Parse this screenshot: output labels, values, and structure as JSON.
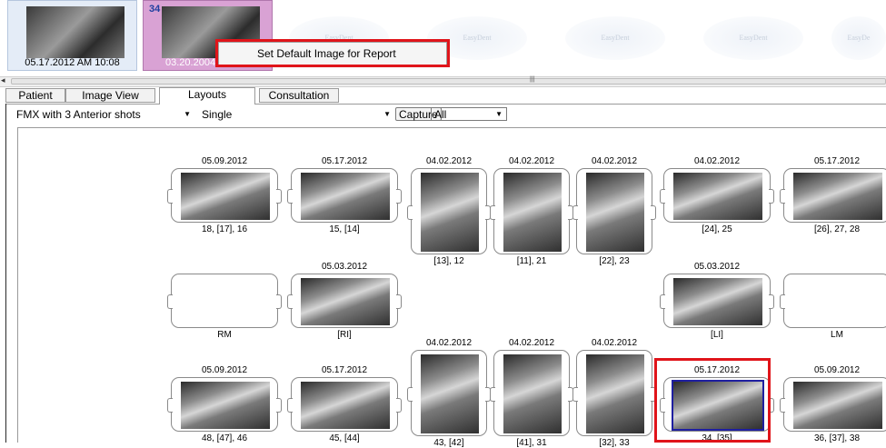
{
  "thumbs": [
    {
      "caption": "05.17.2012 AM 10:08"
    },
    {
      "number": "34",
      "caption": "03.20.2004 PM 08:"
    }
  ],
  "placeholders": [
    "EasyDent",
    "EasyDent",
    "EasyDent",
    "EasyDent",
    "EasyDe"
  ],
  "context_menu": {
    "item": "Set Default Image for Report"
  },
  "tabs": [
    {
      "label": "Patient"
    },
    {
      "label": "Image View"
    },
    {
      "label": "Layouts"
    },
    {
      "label": "Consultation"
    }
  ],
  "active_tab": "Layouts",
  "controls": {
    "layout_select": "FMX with 3 Anterior shots",
    "mode_select": "Single",
    "capture_button": "Capture",
    "filter_select": "All"
  },
  "slots": [
    {
      "date": "05.09.2012",
      "label": "18, [17], 16",
      "has_image": true
    },
    {
      "date": "05.17.2012",
      "label": "15, [14]",
      "has_image": true
    },
    {
      "date": "04.02.2012",
      "label": "[13], 12",
      "has_image": true
    },
    {
      "date": "04.02.2012",
      "label": "[11], 21",
      "has_image": true
    },
    {
      "date": "04.02.2012",
      "label": "[22], 23",
      "has_image": true
    },
    {
      "date": "04.02.2012",
      "label": "[24], 25",
      "has_image": true
    },
    {
      "date": "05.17.2012",
      "label": "[26], 27, 28",
      "has_image": true
    },
    {
      "date": "",
      "label": "RM",
      "has_image": false
    },
    {
      "date": "05.03.2012",
      "label": "[RI]",
      "has_image": true
    },
    {
      "date": "05.03.2012",
      "label": "[LI]",
      "has_image": true
    },
    {
      "date": "",
      "label": "LM",
      "has_image": false
    },
    {
      "date": "05.09.2012",
      "label": "48, [47], 46",
      "has_image": true
    },
    {
      "date": "05.17.2012",
      "label": "45, [44]",
      "has_image": true
    },
    {
      "date": "04.02.2012",
      "label": "43, [42]",
      "has_image": true
    },
    {
      "date": "04.02.2012",
      "label": "[41], 31",
      "has_image": true
    },
    {
      "date": "04.02.2012",
      "label": "[32], 33",
      "has_image": true
    },
    {
      "date": "05.17.2012",
      "label": "34, [35]",
      "has_image": true,
      "selected": true
    },
    {
      "date": "05.09.2012",
      "label": "36, [37], 38",
      "has_image": true
    }
  ],
  "colors": {
    "highlight_red": "#e0141a",
    "selection_blue": "#1f1fa0",
    "active_thumb": "#d9a2d4"
  }
}
